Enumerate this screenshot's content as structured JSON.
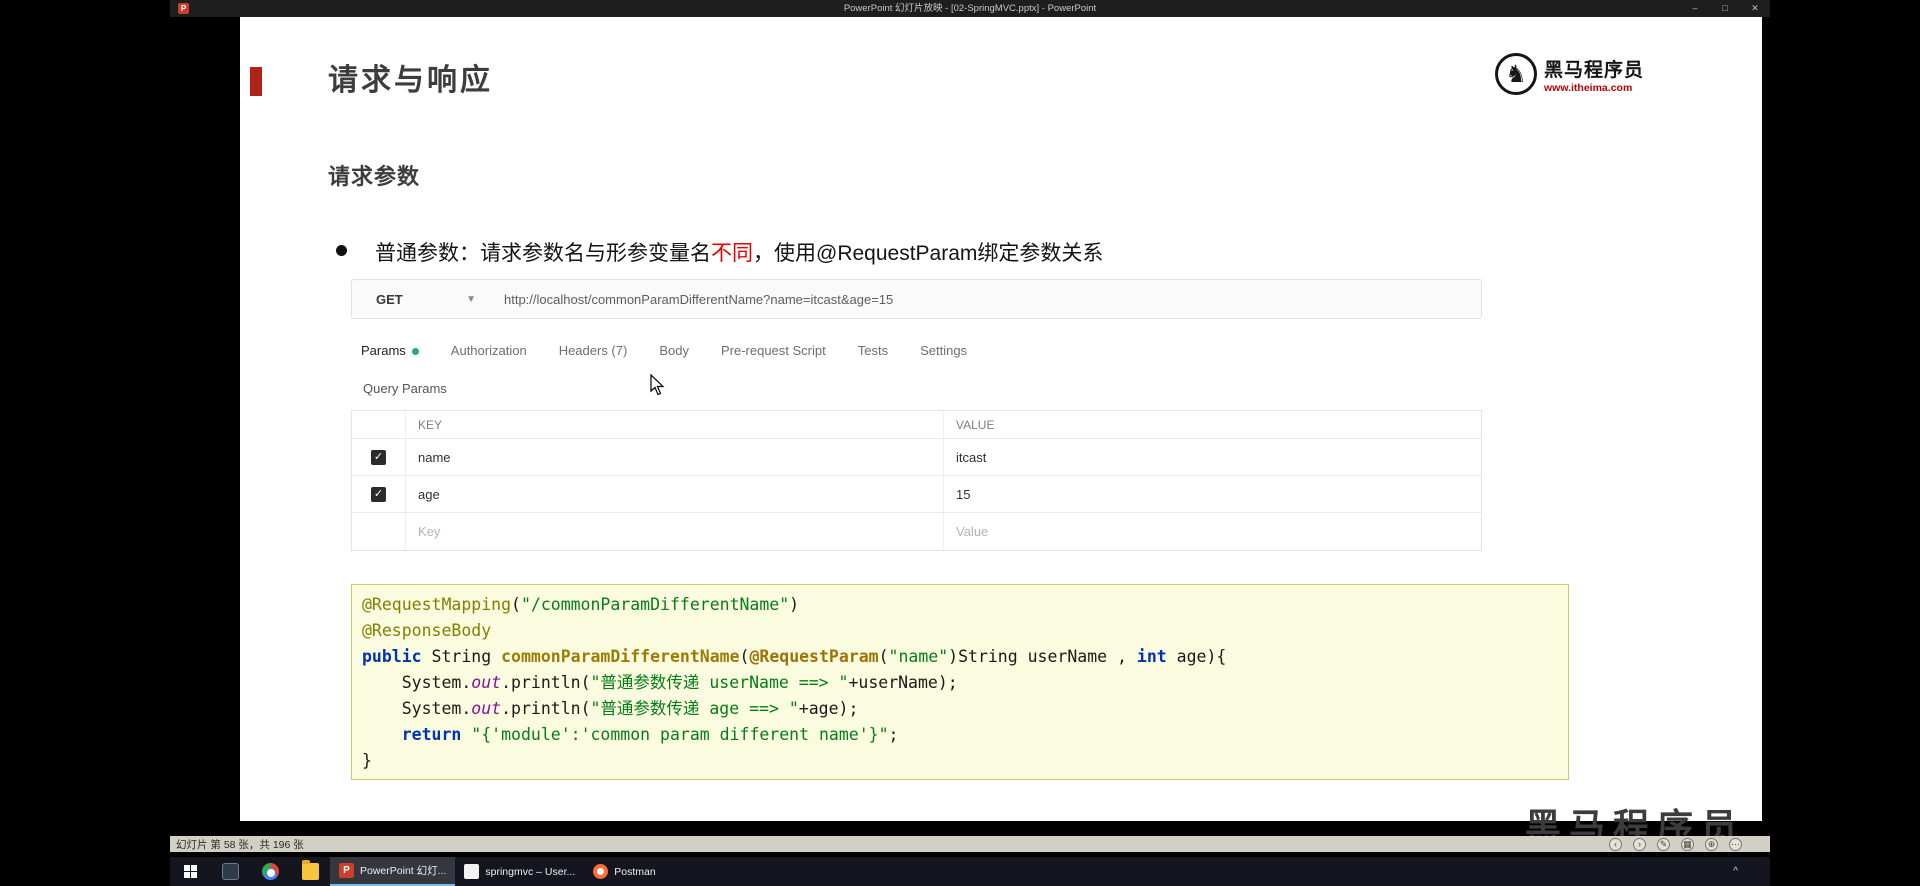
{
  "window": {
    "title": "PowerPoint 幻灯片放映 - [02-SpringMVC.pptx] - PowerPoint",
    "controls": {
      "minimize": "–",
      "maximize": "□",
      "close": "✕"
    }
  },
  "slide": {
    "title": "请求与响应",
    "subtitle": "请求参数",
    "bullet": {
      "pre": "普通参数：请求参数名与形参变量名",
      "highlight": "不同",
      "post": "，使用@RequestParam绑定参数关系"
    },
    "logo": {
      "name": "黑马程序员",
      "url": "www.itheima.com"
    }
  },
  "postman": {
    "method": "GET",
    "url": "http://localhost/commonParamDifferentName?name=itcast&age=15",
    "tabs": [
      {
        "label": "Params",
        "active": true,
        "dot": true
      },
      {
        "label": "Authorization"
      },
      {
        "label": "Headers (7)"
      },
      {
        "label": "Body"
      },
      {
        "label": "Pre-request Script"
      },
      {
        "label": "Tests"
      },
      {
        "label": "Settings"
      }
    ],
    "section_label": "Query Params",
    "table": {
      "columns": [
        "KEY",
        "VALUE"
      ],
      "rows": [
        {
          "checked": true,
          "key": "name",
          "value": "itcast",
          "placeholder": false
        },
        {
          "checked": true,
          "key": "age",
          "value": "15",
          "placeholder": false
        },
        {
          "checked": false,
          "key": "Key",
          "value": "Value",
          "placeholder": true
        }
      ]
    }
  },
  "code": {
    "lines": [
      [
        {
          "t": "@RequestMapping",
          "c": "ann"
        },
        {
          "t": "(",
          "c": "pl"
        },
        {
          "t": "\"/commonParamDifferentName\"",
          "c": "str"
        },
        {
          "t": ")",
          "c": "pl"
        }
      ],
      [
        {
          "t": "@ResponseBody",
          "c": "ann"
        }
      ],
      [
        {
          "t": "public ",
          "c": "kw"
        },
        {
          "t": "String ",
          "c": "pl"
        },
        {
          "t": "commonParamDifferentName",
          "c": "meth"
        },
        {
          "t": "(",
          "c": "pl"
        },
        {
          "t": "@RequestParam",
          "c": "annb"
        },
        {
          "t": "(",
          "c": "pl"
        },
        {
          "t": "\"name\"",
          "c": "str"
        },
        {
          "t": ")String userName , ",
          "c": "pl"
        },
        {
          "t": "int",
          "c": "kw"
        },
        {
          "t": " age){",
          "c": "pl"
        }
      ],
      [
        {
          "t": "    System.",
          "c": "pl"
        },
        {
          "t": "out",
          "c": "field"
        },
        {
          "t": ".println(",
          "c": "pl"
        },
        {
          "t": "\"普通参数传递 userName ==> \"",
          "c": "str"
        },
        {
          "t": "+userName);",
          "c": "pl"
        }
      ],
      [
        {
          "t": "    System.",
          "c": "pl"
        },
        {
          "t": "out",
          "c": "field"
        },
        {
          "t": ".println(",
          "c": "pl"
        },
        {
          "t": "\"普通参数传递 age ==> \"",
          "c": "str"
        },
        {
          "t": "+age);",
          "c": "pl"
        }
      ],
      [
        {
          "t": "    ",
          "c": "pl"
        },
        {
          "t": "return ",
          "c": "kw"
        },
        {
          "t": "\"{'module':'common param different name'}\"",
          "c": "str"
        },
        {
          "t": ";",
          "c": "pl"
        }
      ],
      [
        {
          "t": "}",
          "c": "pl"
        }
      ]
    ]
  },
  "statusbar": {
    "text": "幻灯片 第 58 张，共 196 张",
    "icons": [
      {
        "name": "previous-slide",
        "glyph": "‹"
      },
      {
        "name": "next-slide",
        "glyph": "›"
      },
      {
        "name": "pen",
        "glyph": "✎"
      },
      {
        "name": "see-all-slides",
        "glyph": "▦"
      },
      {
        "name": "zoom",
        "glyph": "⊕"
      },
      {
        "name": "more-options",
        "glyph": "⋯"
      }
    ]
  },
  "taskbar": {
    "apps": [
      {
        "label": "PowerPoint 幻灯...",
        "active": true,
        "icon": "powerpoint"
      },
      {
        "label": "springmvc – User...",
        "active": false,
        "icon": "intellij"
      },
      {
        "label": "Postman",
        "active": false,
        "icon": "postman"
      }
    ],
    "tray_chevron": "^"
  },
  "watermark": "黑马程序员"
}
